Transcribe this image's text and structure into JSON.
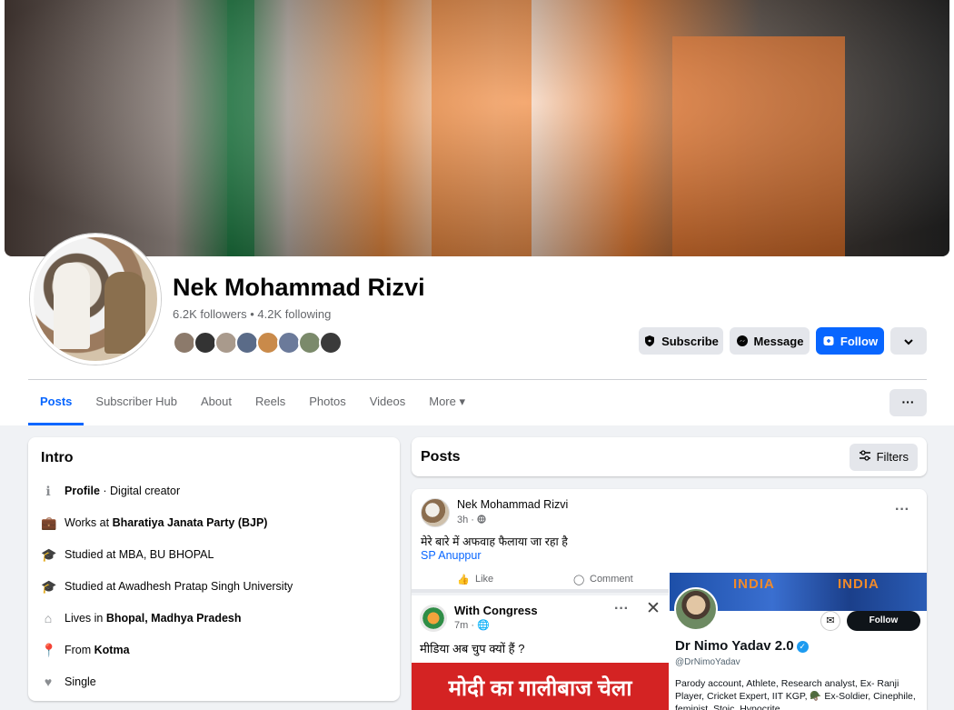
{
  "profile": {
    "name": "Nek Mohammad Rizvi",
    "stats": "6.2K followers • 4.2K following"
  },
  "actions": {
    "subscribe": "Subscribe",
    "message": "Message",
    "follow": "Follow"
  },
  "tabs": [
    {
      "label": "Posts",
      "active": true
    },
    {
      "label": "Subscriber Hub"
    },
    {
      "label": "About"
    },
    {
      "label": "Reels"
    },
    {
      "label": "Photos"
    },
    {
      "label": "Videos"
    },
    {
      "label": "More ▾"
    }
  ],
  "intro": {
    "title": "Intro",
    "rows": [
      {
        "icon": "info-icon",
        "bold": "Profile",
        "text": " · Digital creator"
      },
      {
        "icon": "briefcase-icon",
        "prefix": "Works at ",
        "bold": "Bharatiya Janata Party (BJP)"
      },
      {
        "icon": "graduation-cap-icon",
        "prefix": "Studied at MBA, BU BHOPAL"
      },
      {
        "icon": "graduation-cap-icon",
        "prefix": "Studied at Awadhesh Pratap Singh University"
      },
      {
        "icon": "home-icon",
        "prefix": "Lives in ",
        "bold": "Bhopal, Madhya Pradesh"
      },
      {
        "icon": "location-pin-icon",
        "prefix": "From ",
        "bold": "Kotma"
      },
      {
        "icon": "heart-icon",
        "prefix": "Single"
      }
    ]
  },
  "posts_section": {
    "title": "Posts",
    "filters": "Filters"
  },
  "post": {
    "author": "Nek Mohammad Rizvi",
    "time": "3h ·",
    "text": "मेरे बारे में अफवाह फैलाया जा रहा है",
    "link": "SP Anuppur",
    "left_shot": {
      "like": "Like",
      "comment": "Comment",
      "page_name": "With Congress",
      "time": "7m ·",
      "text": "मीडिया अब चुप क्यों हैं ?",
      "banner": "मोदी का गालीबाज चेला"
    },
    "right_shot": {
      "banner_text": "INDIA",
      "follow": "Follow",
      "name": "Dr Nimo Yadav 2.0",
      "handle": "@DrNimoYadav",
      "bio": "Parody account, Athlete, Research analyst, Ex- Ranji Player, Cricket Expert, IIT KGP, 🪖 Ex-Soldier, Cinephile, feminist, Stoic, Hypocrite"
    }
  }
}
